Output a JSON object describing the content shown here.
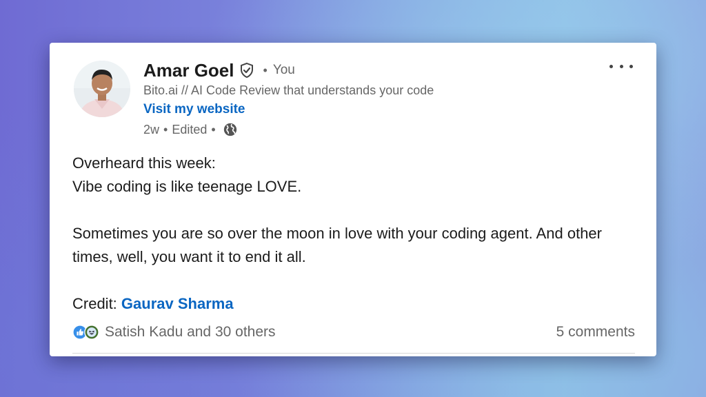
{
  "post": {
    "author": {
      "name": "Amar Goel",
      "relation": "You",
      "headline": "Bito.ai // AI Code Review that understands your code",
      "website_link": "Visit my website",
      "avatar_icon": "profile-photo",
      "verified_icon": "verified-shield-icon"
    },
    "meta": {
      "age": "2w",
      "edited": "Edited",
      "visibility_icon": "globe-icon"
    },
    "body": {
      "line1": "Overheard this week:",
      "line2": "Vibe coding is like teenage LOVE.",
      "paragraph2": "Sometimes you are so over the moon in love with your coding agent. And other times, well, you want it to end it all.",
      "credit_label": "Credit:",
      "credit_name": "Gaurav Sharma"
    },
    "social": {
      "reactors": "Satish Kadu and 30 others",
      "comments": "5 comments",
      "reaction_icons": [
        "like-icon",
        "funny-icon"
      ]
    }
  },
  "colors": {
    "link": "#0a66c2",
    "secondary_text": "#666666",
    "primary_text": "#1b1b1b"
  }
}
